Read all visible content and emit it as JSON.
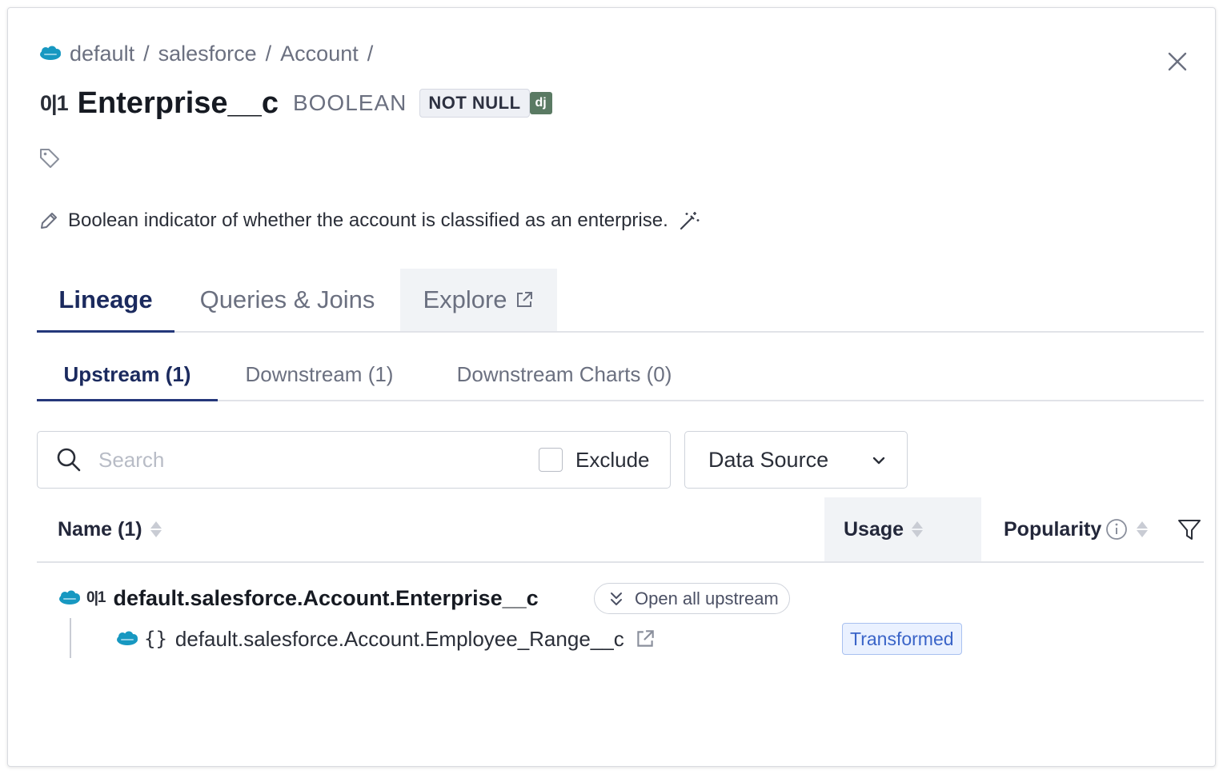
{
  "breadcrumb": {
    "icon": "salesforce-icon",
    "items": [
      "default",
      "salesforce",
      "Account"
    ],
    "separator": "/"
  },
  "header": {
    "type_glyph": "0|1",
    "title": "Enterprise__c",
    "datatype": "BOOLEAN",
    "constraint": "NOT NULL",
    "source_badge": "dj"
  },
  "description": "Boolean indicator of whether the account is classified as an enterprise.",
  "main_tabs": [
    {
      "label": "Lineage",
      "active": true
    },
    {
      "label": "Queries & Joins",
      "active": false
    },
    {
      "label": "Explore",
      "active": false,
      "external": true
    }
  ],
  "sub_tabs": [
    {
      "label": "Upstream (1)",
      "active": true
    },
    {
      "label": "Downstream (1)",
      "active": false
    },
    {
      "label": "Downstream Charts (0)",
      "active": false
    }
  ],
  "filters": {
    "search_placeholder": "Search",
    "search_value": "",
    "exclude_label": "Exclude",
    "exclude_checked": false,
    "datasource_label": "Data Source"
  },
  "table": {
    "columns": [
      {
        "label": "Name (1)",
        "sortable": true
      },
      {
        "label": "Usage",
        "sortable": true
      },
      {
        "label": "Popularity",
        "sortable": true,
        "info": true
      }
    ],
    "rows": [
      {
        "type_glyph": "0|1",
        "name": "default.salesforce.Account.Enterprise__c",
        "action": "Open all upstream",
        "children": [
          {
            "type_glyph": "{}",
            "name": "default.salesforce.Account.Employee_Range__c",
            "usage": "Transformed"
          }
        ]
      }
    ]
  },
  "colors": {
    "accent": "#24377a",
    "salesforce": "#1798c1",
    "badge_text": "#3a64c8",
    "badge_bg": "#eaf1ff"
  }
}
